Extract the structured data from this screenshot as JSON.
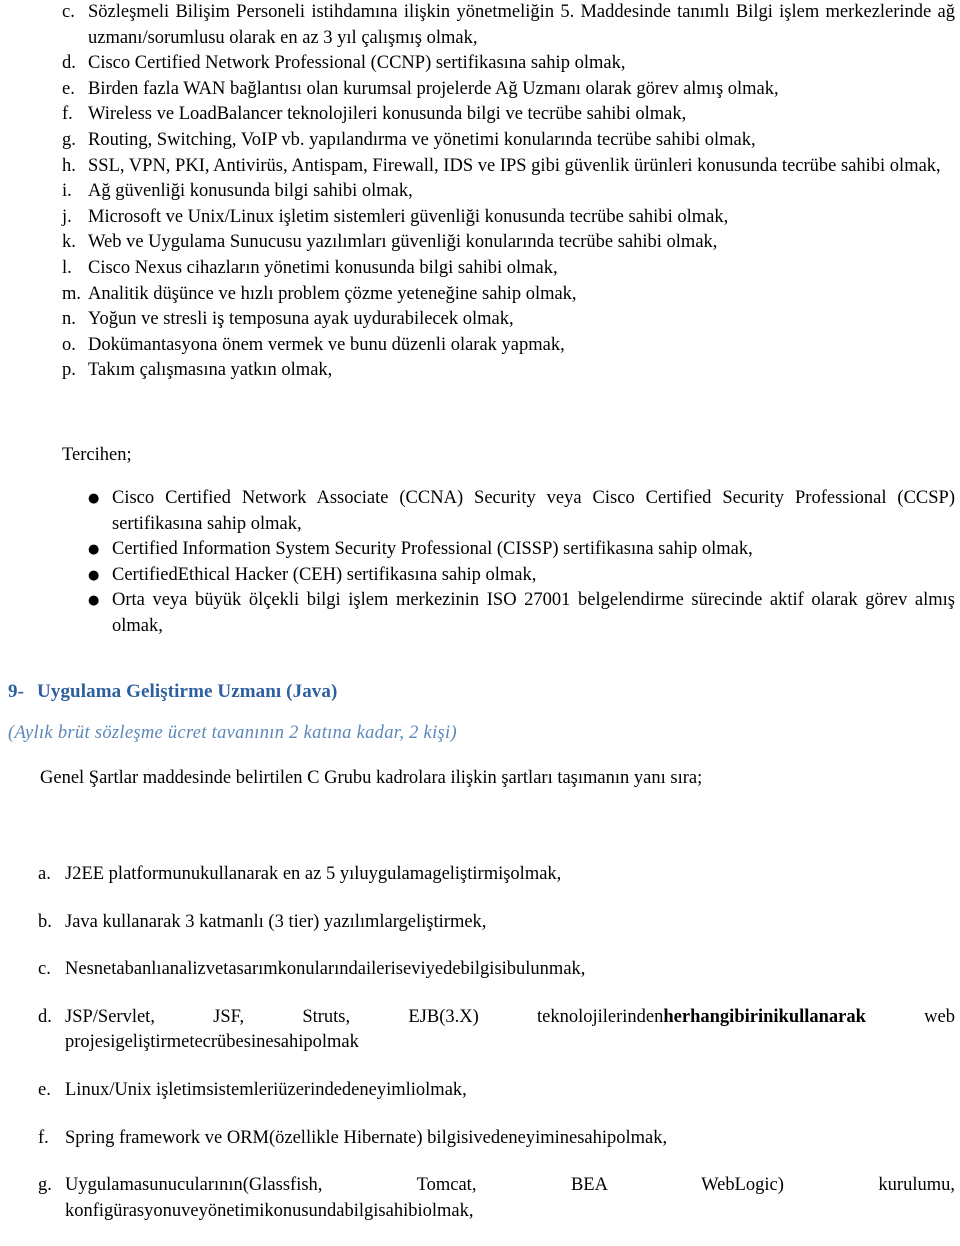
{
  "document": {
    "language": "tr",
    "page_background": "#ffffff",
    "text_color": "#000000",
    "heading_color": "#2E5F9E",
    "subheading_color": "#5B86B8"
  },
  "requirements_list": {
    "items": [
      {
        "marker": "c.",
        "text": "Sözleşmeli Bilişim Personeli istihdamına ilişkin yönetmeliğin 5. Maddesinde tanımlı Bilgi işlem merkezlerinde ağ uzmanı/sorumlusu olarak en az 3 yıl çalışmış olmak,",
        "justify": true
      },
      {
        "marker": "d.",
        "text": "Cisco Certified Network Professional (CCNP) sertifikasına sahip olmak,",
        "justify": false
      },
      {
        "marker": "e.",
        "text": "Birden fazla WAN bağlantısı olan kurumsal projelerde Ağ Uzmanı olarak görev almış olmak,",
        "justify": false
      },
      {
        "marker": "f.",
        "text": "Wireless ve LoadBalancer teknolojileri konusunda bilgi ve tecrübe sahibi olmak,",
        "justify": false
      },
      {
        "marker": "g.",
        "text": "Routing, Switching, VoIP vb. yapılandırma ve yönetimi konularında tecrübe sahibi olmak,",
        "justify": false
      },
      {
        "marker": "h.",
        "text": "SSL, VPN, PKI, Antivirüs, Antispam, Firewall, IDS ve IPS gibi güvenlik ürünleri konusunda tecrübe sahibi olmak,",
        "justify": true
      },
      {
        "marker": "i.",
        "text": "Ağ güvenliği konusunda bilgi sahibi olmak,",
        "justify": false
      },
      {
        "marker": "j.",
        "text": "Microsoft ve Unix/Linux işletim sistemleri güvenliği konusunda tecrübe sahibi olmak,",
        "justify": false
      },
      {
        "marker": "k.",
        "text": "Web ve Uygulama Sunucusu yazılımları güvenliği konularında tecrübe sahibi olmak,",
        "justify": false
      },
      {
        "marker": "l.",
        "text": "Cisco Nexus cihazların yönetimi konusunda bilgi sahibi olmak,",
        "justify": false
      },
      {
        "marker": "m.",
        "text": "Analitik düşünce ve hızlı problem çözme yeteneğine sahip olmak,",
        "justify": false
      },
      {
        "marker": "n.",
        "text": "Yoğun ve stresli iş temposuna ayak uydurabilecek olmak,",
        "justify": false
      },
      {
        "marker": "o.",
        "text": "Dokümantasyona önem vermek ve bunu düzenli olarak yapmak,",
        "justify": false
      },
      {
        "marker": "p.",
        "text": "Takım çalışmasına yatkın olmak,",
        "justify": false
      }
    ]
  },
  "preferred_section": {
    "label": "Tercihen;",
    "bullet_glyph": "●",
    "items": [
      {
        "text": "Cisco Certified Network Associate (CCNA) Security veya Cisco Certified Security Professional (CCSP) sertifikasına sahip olmak,",
        "justify": true
      },
      {
        "text": "Certified Information System Security Professional (CISSP) sertifikasına sahip olmak,",
        "justify": false
      },
      {
        "text": "CertifiedEthical Hacker (CEH) sertifikasına sahip olmak,",
        "justify": false
      },
      {
        "text": "Orta veya büyük ölçekli bilgi işlem merkezinin ISO 27001 belgelendirme sürecinde aktif olarak görev almış olmak,",
        "justify": true
      }
    ]
  },
  "position_heading": {
    "number": "9-",
    "title": "Uygulama Geliştirme Uzmanı (Java)",
    "subtitle": "(Aylık brüt sözleşme ücret tavanının 2 katına kadar, 2 kişi)",
    "intro": "Genel Şartlar maddesinde belirtilen C Grubu kadrolara ilişkin şartları taşımanın yanı sıra;"
  },
  "qualifications_list": {
    "items": [
      {
        "marker": "a.",
        "text": "J2EE platformunukullanarak en az 5 yıluygulamageliştirmişolmak,",
        "justify": false,
        "bold_part": ""
      },
      {
        "marker": "b.",
        "text": "Java kullanarak 3 katmanlı (3 tier) yazılımlargeliştirmek,",
        "justify": false,
        "bold_part": ""
      },
      {
        "marker": "c.",
        "text": "Nesnetabanlıanalizvetasarımkonularındaileriseviyedebilgisibulunmak,",
        "justify": false,
        "bold_part": ""
      },
      {
        "marker": "d.",
        "text_before": "JSP/Servlet, JSF, Struts, EJB(3.X) teknolojilerinden",
        "bold_part": "herhangibirinikullanarak",
        "text_after": " web projesigeliştirmetecrübesinesahipolmak",
        "justify": true
      },
      {
        "marker": "e.",
        "text": "Linux/Unix işletimsistemleriüzerindedeneyimliolmak,",
        "justify": false,
        "bold_part": ""
      },
      {
        "marker": "f.",
        "text": "Spring framework  ve ORM(özellikle Hibernate) bilgisivedeneyiminesahipolmak,",
        "justify": false,
        "bold_part": ""
      },
      {
        "marker": "g.",
        "text": "Uygulamasunucularının(Glassfish, Tomcat, BEA WebLogic) kurulumu, konfigürasyonuveyönetimikonusundabilgisahibiolmak,",
        "justify": true,
        "bold_part": ""
      }
    ]
  }
}
